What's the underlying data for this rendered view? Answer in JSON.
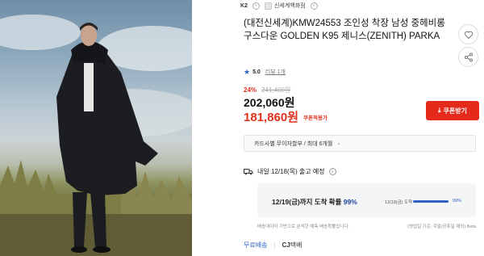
{
  "breadcrumb": {
    "brand": "K2",
    "store": "신세계백화점"
  },
  "product": {
    "title": "(대전신세계)KMW24553 조인성 착장 남성 중헤비롱 구스다운 GOLDEN K95 제니스(ZENITH) PARKA",
    "rating_score": "5.0",
    "review_count": "리뷰 1개"
  },
  "price": {
    "discount_rate": "24%",
    "original": "241,400원",
    "sale": "202,060원",
    "coupon_price": "181,860원",
    "coupon_tag": "쿠폰적용가"
  },
  "coupon_button": {
    "label": "쿠폰받기"
  },
  "card": {
    "text": "카드사별 무이자할부 / 최대 6개월"
  },
  "delivery": {
    "text": "내일 12/18(목) 출고 예정",
    "probability_text": "12/19(금)까지 도착 확률",
    "probability_value": "99%",
    "bar_date": "12/19(금) 도착",
    "bar_pct": "99%",
    "bar_fraction": 0.99,
    "note_left": "배송데이터 기반으로 분석한 예측 배송확률입니다.",
    "note_right": "(영업일 기준, 주말/공휴일 제외) Beta"
  },
  "shipping": {
    "free": "무료배송",
    "carrier_prefix": "CJ",
    "carrier": "택배"
  },
  "colors": {
    "accent_red": "#e52a1c",
    "accent_blue": "#2f63c8"
  }
}
